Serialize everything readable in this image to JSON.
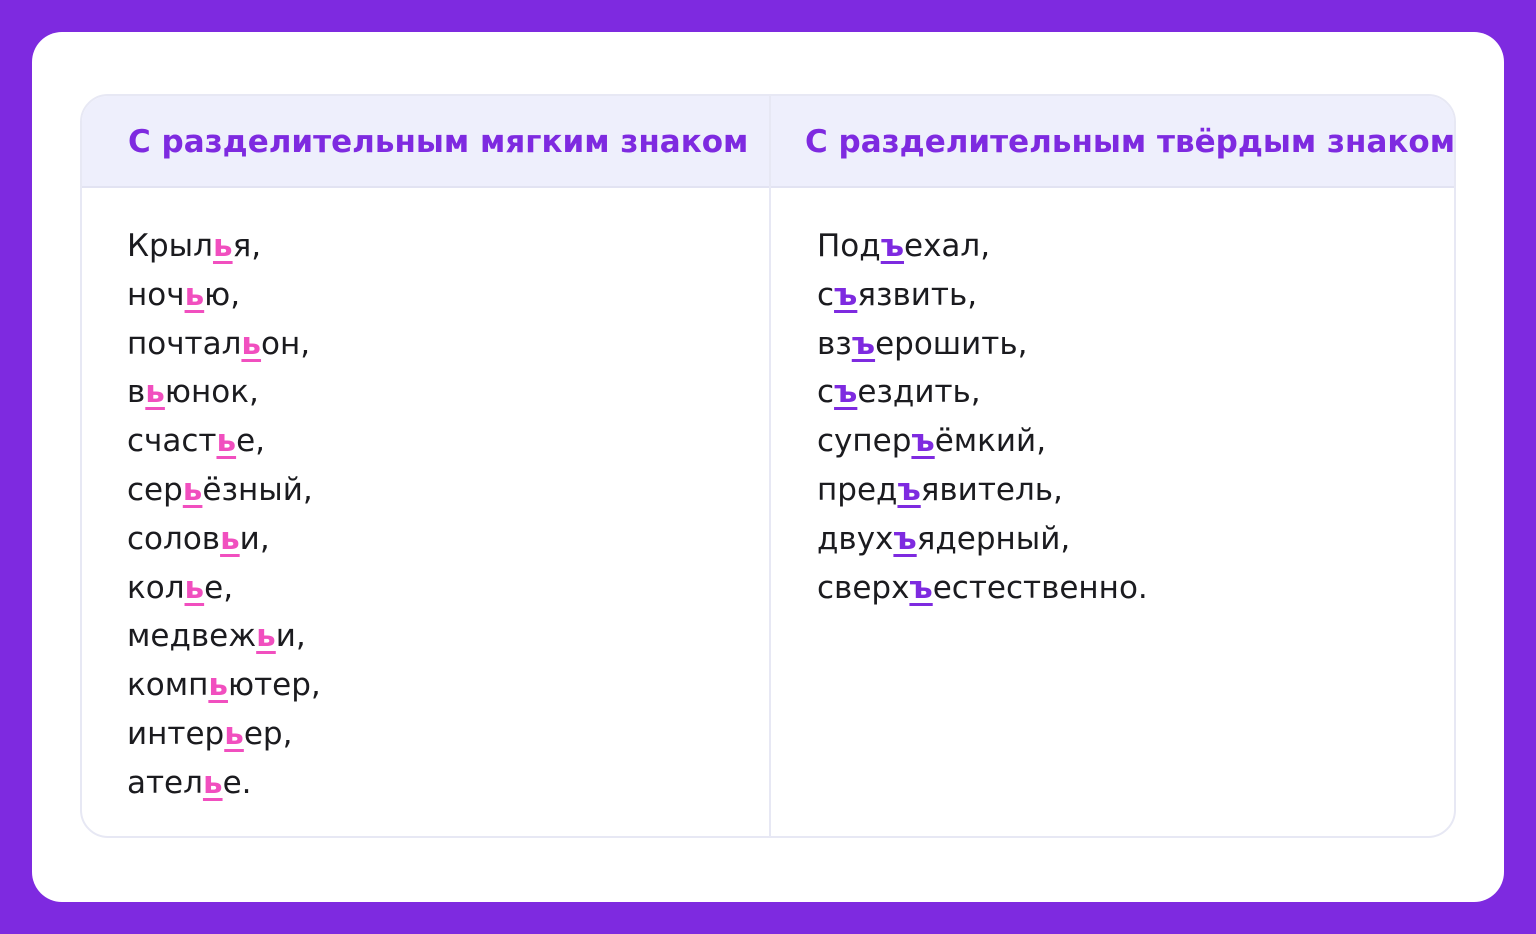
{
  "colors": {
    "background": "#7e2ae0",
    "card": "#ffffff",
    "header_background": "#eeeffc",
    "header_text": "#7e2ae0",
    "soft_sign_highlight": "#f14fbf",
    "hard_sign_highlight": "#7e2ae0",
    "word_text": "#1b1b1f"
  },
  "table": {
    "soft_sign": {
      "header": "С разделительным мягким знаком",
      "words": [
        {
          "before": "Крыл",
          "sign": "ь",
          "after": "я,"
        },
        {
          "before": "ноч",
          "sign": "ь",
          "after": "ю,"
        },
        {
          "before": "почтал",
          "sign": "ь",
          "after": "он,"
        },
        {
          "before": "в",
          "sign": "ь",
          "after": "юнок,"
        },
        {
          "before": "счаст",
          "sign": "ь",
          "after": "е,"
        },
        {
          "before": "сер",
          "sign": "ь",
          "after": "ёзный,"
        },
        {
          "before": "солов",
          "sign": "ь",
          "after": "и,"
        },
        {
          "before": "кол",
          "sign": "ь",
          "after": "е,"
        },
        {
          "before": "медвеж",
          "sign": "ь",
          "after": "и,"
        },
        {
          "before": "комп",
          "sign": "ь",
          "after": "ютер,"
        },
        {
          "before": "интер",
          "sign": "ь",
          "after": "ер,"
        },
        {
          "before": "ател",
          "sign": "ь",
          "after": "е."
        }
      ]
    },
    "hard_sign": {
      "header": "С разделительным твёрдым знаком",
      "words": [
        {
          "before": "Под",
          "sign": "ъ",
          "after": "ехал,"
        },
        {
          "before": "с",
          "sign": "ъ",
          "after": "язвить,"
        },
        {
          "before": "вз",
          "sign": "ъ",
          "after": "ерошить,"
        },
        {
          "before": "с",
          "sign": "ъ",
          "after": "ездить,"
        },
        {
          "before": "супер",
          "sign": "ъ",
          "after": "ёмкий,"
        },
        {
          "before": "пред",
          "sign": "ъ",
          "after": "явитель,"
        },
        {
          "before": "двух",
          "sign": "ъ",
          "after": "ядерный,"
        },
        {
          "before": "сверх",
          "sign": "ъ",
          "after": "естественно."
        }
      ]
    }
  }
}
